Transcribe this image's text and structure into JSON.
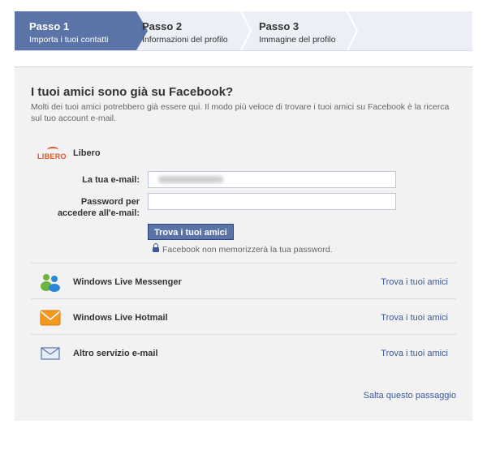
{
  "steps": [
    {
      "title": "Passo 1",
      "subtitle": "Importa i tuoi contatti",
      "active": true
    },
    {
      "title": "Passo 2",
      "subtitle": "Informazioni del profilo",
      "active": false
    },
    {
      "title": "Passo 3",
      "subtitle": "Immagine del profilo",
      "active": false
    }
  ],
  "main": {
    "heading": "I tuoi amici sono già su Facebook?",
    "intro": "Molti dei tuoi amici potrebbero già essere qui. Il modo più veloce di trovare i tuoi amici su Facebook è la ricerca sul tuo account e-mail.",
    "libero": {
      "logo_text": "LIBERO",
      "name": "Libero",
      "email_label": "La tua e-mail:",
      "password_label_line1": "Password per",
      "password_label_line2": "accedere all'e-mail:",
      "password_value": "",
      "find_button": "Trova i tuoi amici",
      "password_note": "Facebook non memorizzerà la tua password."
    },
    "services": [
      {
        "name": "Windows Live Messenger",
        "icon": "messenger-icon",
        "link": "Trova i tuoi amici"
      },
      {
        "name": "Windows Live Hotmail",
        "icon": "hotmail-icon",
        "link": "Trova i tuoi amici"
      },
      {
        "name": "Altro servizio e-mail",
        "icon": "email-envelope-icon",
        "link": "Trova i tuoi amici"
      }
    ],
    "skip_link": "Salta questo passaggio"
  },
  "colors": {
    "active_step": "#5b74a8",
    "link": "#3b5998",
    "panel_bg": "#f2f2f2",
    "libero_brand": "#e2542b"
  }
}
